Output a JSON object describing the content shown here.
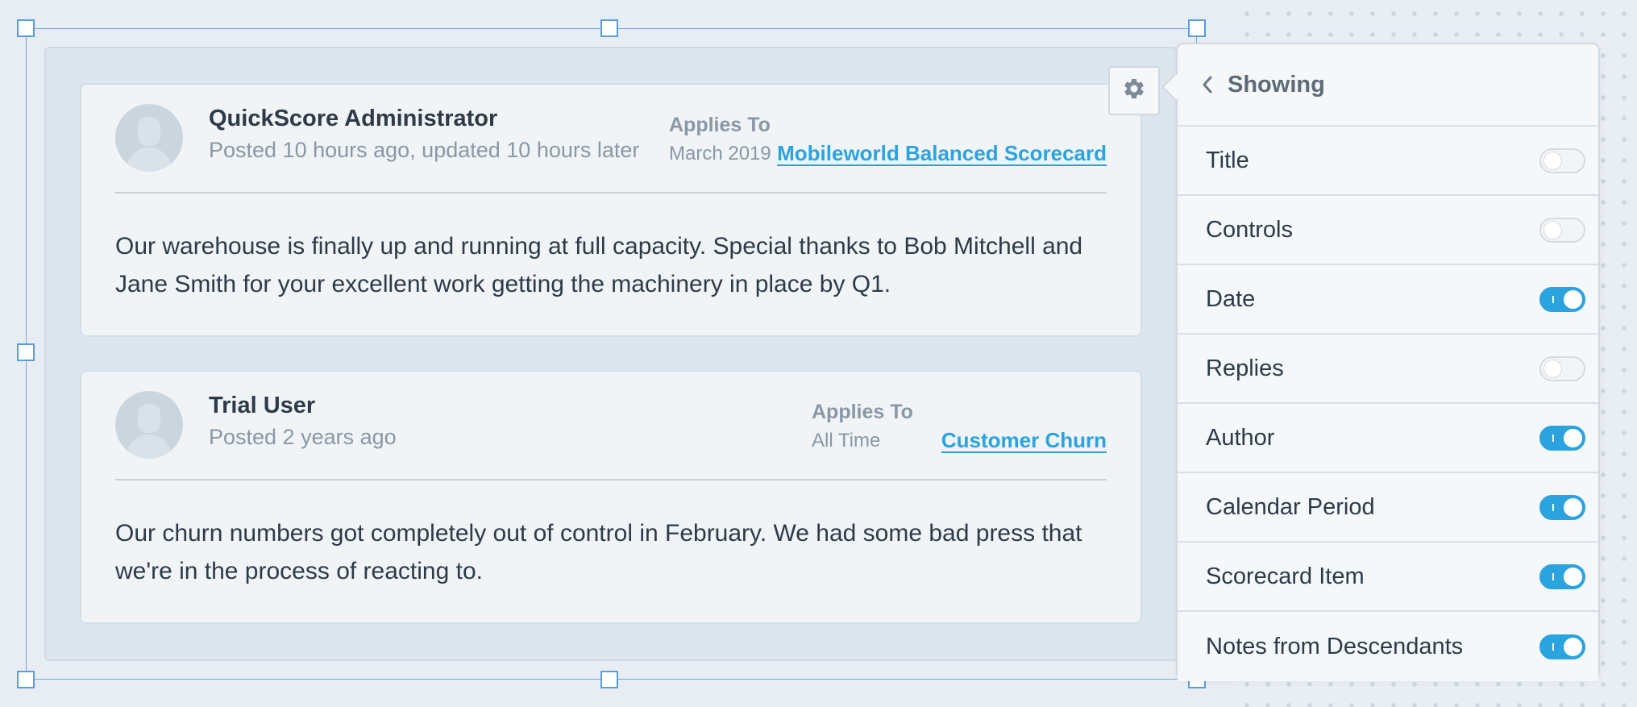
{
  "notes": [
    {
      "author": "QuickScore Administrator",
      "posted": "Posted 10 hours ago, updated 10 hours later",
      "applies_label": "Applies To",
      "applies_value": "March 2019",
      "link": "Mobileworld Balanced Scorecard",
      "text": "Our warehouse is finally up and running at full capacity. Special thanks to Bob Mitchell and Jane Smith for your excellent work getting the machinery in place by Q1."
    },
    {
      "author": "Trial User",
      "posted": "Posted 2 years ago",
      "applies_label": "Applies To",
      "applies_value": "All Time",
      "link": "Customer Churn",
      "text": "Our churn numbers got completely out of control in February. We had some bad press that we're in the process of reacting to."
    }
  ],
  "settings": {
    "title": "Showing",
    "items": [
      {
        "label": "Title",
        "on": false
      },
      {
        "label": "Controls",
        "on": false
      },
      {
        "label": "Date",
        "on": true
      },
      {
        "label": "Replies",
        "on": false
      },
      {
        "label": "Author",
        "on": true
      },
      {
        "label": "Calendar Period",
        "on": true
      },
      {
        "label": "Scorecard Item",
        "on": true
      },
      {
        "label": "Notes from Descendants",
        "on": true
      }
    ]
  },
  "icons": {
    "gear": "gear-icon",
    "back": "chevron-left-icon",
    "avatar": "user-avatar-icon"
  },
  "colors": {
    "accent": "#2aa3df",
    "selection": "#5b9be0"
  }
}
